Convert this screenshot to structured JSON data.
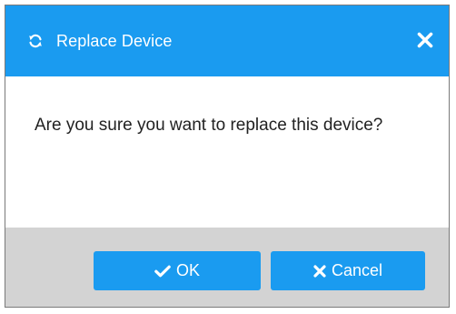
{
  "dialog": {
    "title": "Replace Device",
    "message": "Are you sure you want to replace this device?",
    "icons": {
      "title_icon": "refresh-icon",
      "close_icon": "close-icon",
      "ok_icon": "checkmark-icon",
      "cancel_icon": "x-icon"
    }
  },
  "buttons": {
    "ok_label": "OK",
    "cancel_label": "Cancel"
  },
  "colors": {
    "accent": "#1a9bf0",
    "footer_bg": "#d3d3d3",
    "text": "#222222"
  }
}
